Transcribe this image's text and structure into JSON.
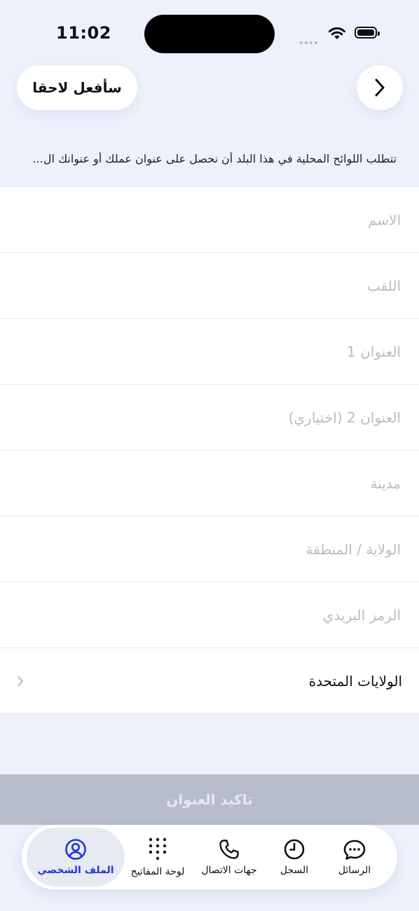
{
  "status_bar": {
    "time": "11:02"
  },
  "header": {
    "later_button": "سأفعل لاحقا",
    "next_icon": "chevron-right-icon"
  },
  "notice": "تتطلب اللوائح المحلية في هذا البلد أن نحصل على عنوان عملك أو عنوانك ال...",
  "form": {
    "first_name_placeholder": "الاسم",
    "last_name_placeholder": "اللقب",
    "address1_placeholder": "العنوان 1",
    "address2_placeholder": "العنوان 2 (اختياري)",
    "city_placeholder": "مدينة",
    "state_placeholder": "الولاية / المنطقة",
    "postal_placeholder": "الرمز البريدي",
    "country": "الولايات المتحدة"
  },
  "confirm_button": "تاكيد العنوان",
  "tabbar": {
    "messages": "الرسائل",
    "history": "السجل",
    "contacts": "جهات الاتصال",
    "keypad": "لوحة المفاتيح",
    "profile": "الملف الشخصي"
  },
  "colors": {
    "background": "#EDF1FC",
    "accent": "#2436D9",
    "disabled_button": "#B8BDCC"
  }
}
